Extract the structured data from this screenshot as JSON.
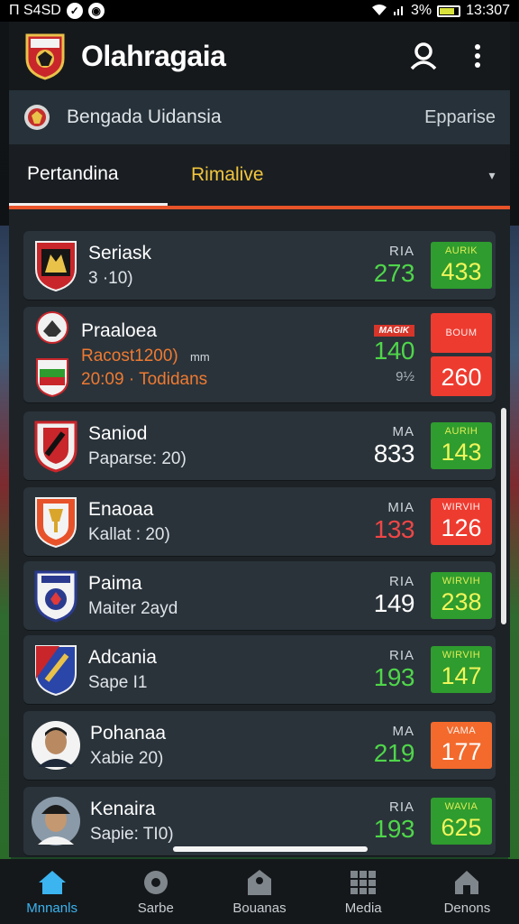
{
  "status_bar": {
    "left_text": "Π S4SD",
    "battery_pct": "3%",
    "time": "13:307"
  },
  "header": {
    "title": "Olahragaia"
  },
  "subbar": {
    "title": "Bengada Uidansia",
    "action": "Epparise"
  },
  "tabs": [
    {
      "label": "Pertandina"
    },
    {
      "label": "Rimalive"
    }
  ],
  "matches": [
    {
      "name": "Seriask",
      "sub": "3 ·10)",
      "odds_label": "RIA",
      "odds_value": "273",
      "odds_color": "green",
      "badge_label": "AURIK",
      "badge_value": "433",
      "badge_color": "green"
    },
    {
      "name": "Praaloea",
      "sub": "Racost1200)",
      "sub_extra": "mm",
      "sub2": "20:09 · Todidans",
      "tag": "MAGIK",
      "odds_value": "140",
      "odds_color": "green",
      "pct": "9½",
      "badge_label": "BOUM",
      "badge_value": "",
      "badge2_value": "260",
      "badge_color": "red"
    },
    {
      "name": "Saniod",
      "sub": "Paparse: 20)",
      "odds_label": "MA",
      "odds_value": "833",
      "odds_color": "white",
      "badge_label": "AURIH",
      "badge_value": "143",
      "badge_color": "green"
    },
    {
      "name": "Enaoaa",
      "sub": "Kallat : 20)",
      "odds_label": "MIA",
      "odds_value": "133",
      "odds_color": "red",
      "badge_label": "WIRVIH",
      "badge_value": "126",
      "badge_color": "red"
    },
    {
      "name": "Paima",
      "sub": "Maiter 2ayd",
      "odds_label": "RIA",
      "odds_value": "149",
      "odds_color": "white",
      "badge_label": "WIRVIH",
      "badge_value": "238",
      "badge_color": "green"
    },
    {
      "name": "Adcania",
      "sub": "Sape I1",
      "odds_label": "RIA",
      "odds_value": "193",
      "odds_color": "green",
      "badge_label": "WIRVIH",
      "badge_value": "147",
      "badge_color": "green"
    },
    {
      "name": "Pohanaa",
      "sub": "Xabie 20)",
      "odds_label": "MA",
      "odds_value": "219",
      "odds_color": "green",
      "badge_label": "VAMA",
      "badge_value": "177",
      "badge_color": "orange"
    },
    {
      "name": "Kenaira",
      "sub": "Sapie: TI0)",
      "odds_label": "RIA",
      "odds_value": "193",
      "odds_color": "green",
      "badge_label": "WAVIA",
      "badge_value": "625",
      "badge_color": "green"
    }
  ],
  "bottom_nav": [
    {
      "label": "Mnnanls",
      "icon": "home-icon"
    },
    {
      "label": "Sarbe",
      "icon": "ball-icon"
    },
    {
      "label": "Bouanas",
      "icon": "tag-icon"
    },
    {
      "label": "Media",
      "icon": "grid-icon"
    },
    {
      "label": "Denons",
      "icon": "house-icon"
    }
  ],
  "colors": {
    "accent": "#e8532a",
    "live": "#f2c53d",
    "green_badge": "#2e9c2e",
    "red_badge": "#ee3b2f",
    "orange_badge": "#f36a2c",
    "active_nav": "#3bb4f0"
  }
}
